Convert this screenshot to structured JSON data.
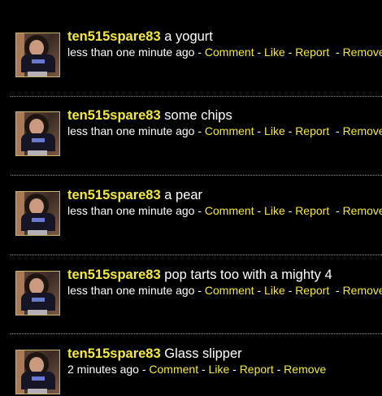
{
  "colors": {
    "background": "#000000",
    "username": "#f4e940",
    "link": "#f4e940",
    "text": "#ffffff",
    "divider": "#9a9a9a"
  },
  "posts": [
    {
      "username": "ten515spare83",
      "message": "a yogurt",
      "time": "less than one minute ago",
      "actions": {
        "comment": "Comment",
        "like": "Like",
        "report": "Report",
        "remove": "Remove"
      }
    },
    {
      "username": "ten515spare83",
      "message": "some chips",
      "time": "less than one minute ago",
      "actions": {
        "comment": "Comment",
        "like": "Like",
        "report": "Report",
        "remove": "Remove"
      }
    },
    {
      "username": "ten515spare83",
      "message": "a pear",
      "time": "less than one minute ago",
      "actions": {
        "comment": "Comment",
        "like": "Like",
        "report": "Report",
        "remove": "Remove"
      }
    },
    {
      "username": "ten515spare83",
      "message": "pop tarts too with a mighty 4",
      "time": "less than one minute ago",
      "actions": {
        "comment": "Comment",
        "like": "Like",
        "report": "Report",
        "remove": "Remove"
      }
    },
    {
      "username": "ten515spare83",
      "message": "Glass slipper",
      "time": "2 minutes ago",
      "actions": {
        "comment": "Comment",
        "like": "Like",
        "report": "Report",
        "remove": "Remove"
      }
    }
  ],
  "separators": {
    "dash": " - "
  }
}
